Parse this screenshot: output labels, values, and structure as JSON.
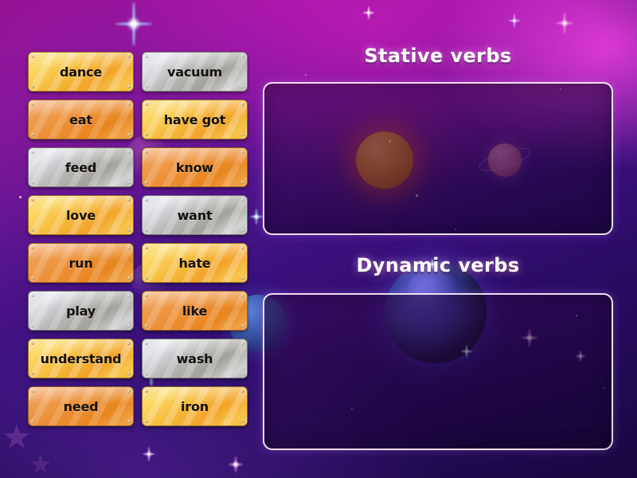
{
  "background": {
    "theme": "space",
    "gradient_from": "#a3119c",
    "gradient_to": "#1b0845"
  },
  "tiles": {
    "columns": [
      [
        {
          "label": "dance",
          "style": "gold"
        },
        {
          "label": "eat",
          "style": "orange"
        },
        {
          "label": "feed",
          "style": "silver"
        },
        {
          "label": "love",
          "style": "gold"
        },
        {
          "label": "run",
          "style": "orange"
        },
        {
          "label": "play",
          "style": "silver"
        },
        {
          "label": "understand",
          "style": "gold"
        },
        {
          "label": "need",
          "style": "orange"
        }
      ],
      [
        {
          "label": "vacuum",
          "style": "silver"
        },
        {
          "label": "have got",
          "style": "gold"
        },
        {
          "label": "know",
          "style": "orange"
        },
        {
          "label": "want",
          "style": "silver"
        },
        {
          "label": "hate",
          "style": "gold"
        },
        {
          "label": "like",
          "style": "orange"
        },
        {
          "label": "wash",
          "style": "silver"
        },
        {
          "label": "iron",
          "style": "gold"
        }
      ]
    ]
  },
  "categories": [
    {
      "title": "Stative verbs",
      "items": []
    },
    {
      "title": "Dynamic verbs",
      "items": []
    }
  ]
}
